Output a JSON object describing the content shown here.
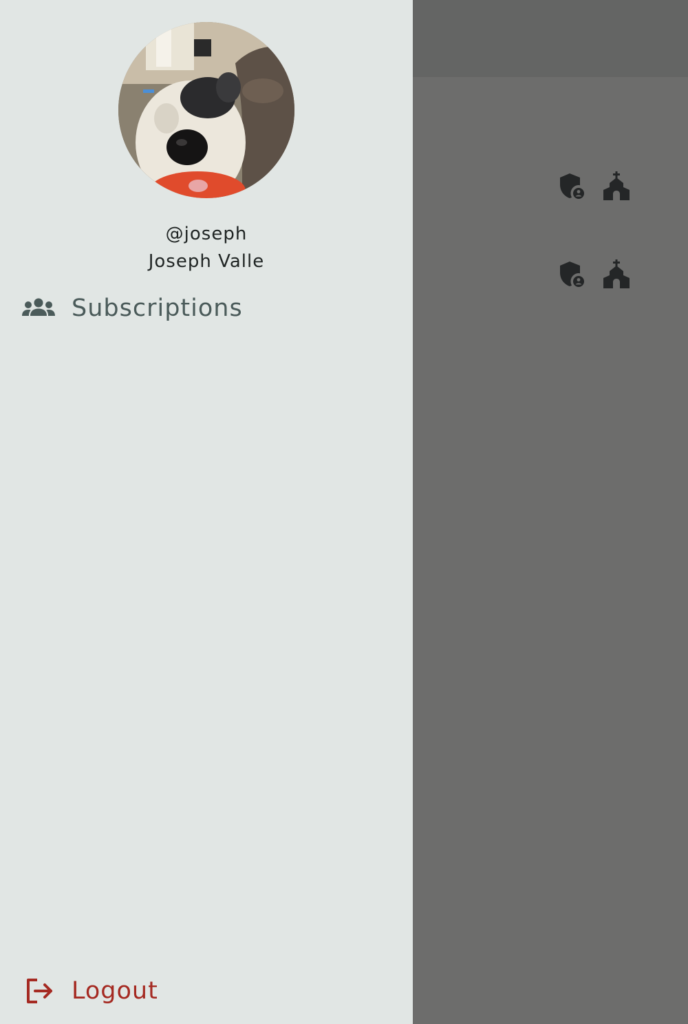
{
  "drawer": {
    "username": "@joseph",
    "full_name": "Joseph Valle",
    "avatar": {
      "icon": "dog-photo-avatar"
    },
    "nav_items": [
      {
        "label": "Subscriptions",
        "icon": "group-icon"
      }
    ],
    "logout": {
      "label": "Logout",
      "icon": "logout-icon"
    }
  },
  "background": {
    "rows": [
      {
        "icons": [
          "shield-person-icon",
          "church-icon"
        ]
      },
      {
        "icons": [
          "shield-person-icon",
          "church-icon"
        ]
      }
    ]
  },
  "colors": {
    "drawer_bg": "#e1e6e4",
    "scrim": "#6d6d6c",
    "appbar": "#646564",
    "nav_text": "#4b5b5a",
    "logout_red": "#a52a22",
    "icon_dark": "#242627"
  }
}
